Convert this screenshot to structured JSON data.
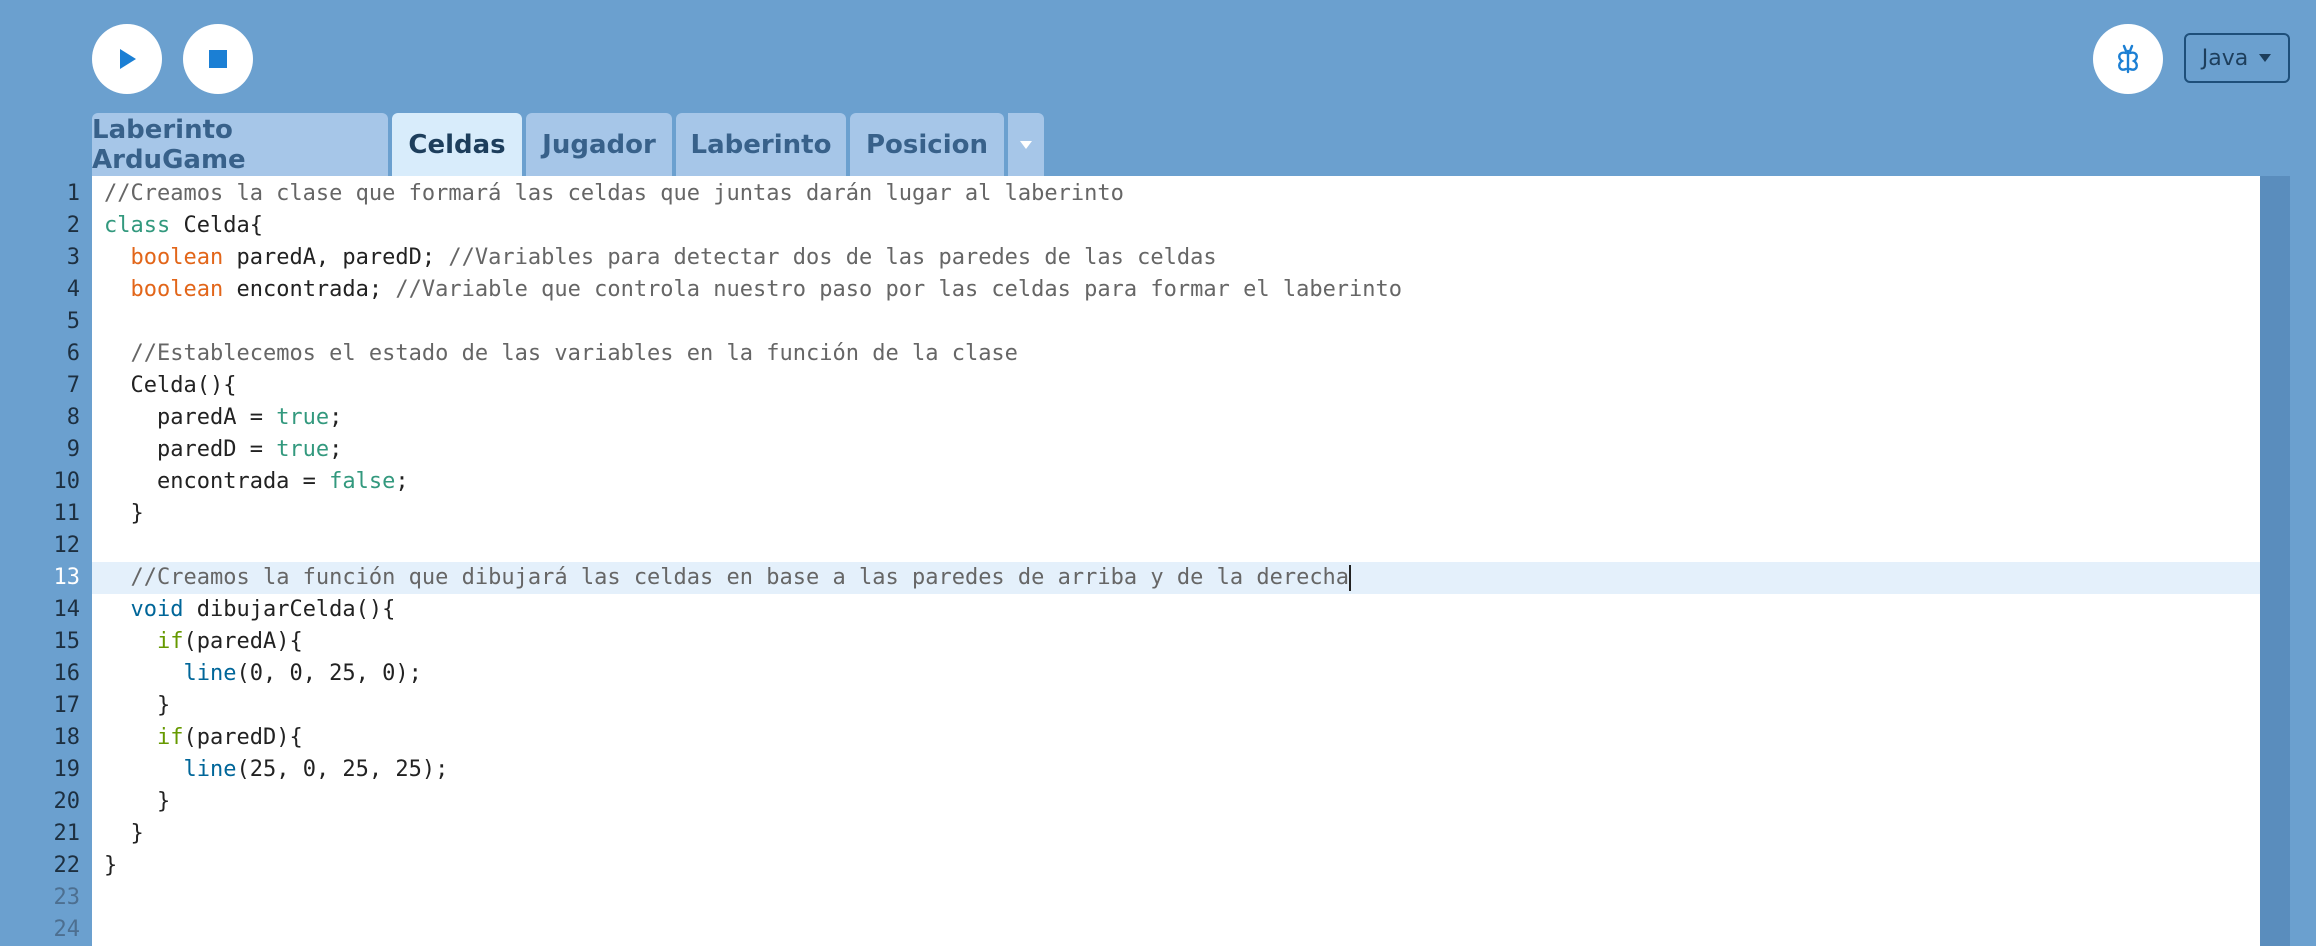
{
  "toolbar": {
    "run_icon": "play-icon",
    "stop_icon": "stop-icon",
    "mode_icon": "butterfly-icon",
    "language": "Java"
  },
  "tabs": [
    {
      "label": "Laberinto ArduGame",
      "active": false
    },
    {
      "label": "Celdas",
      "active": true
    },
    {
      "label": "Jugador",
      "active": false
    },
    {
      "label": "Laberinto",
      "active": false
    },
    {
      "label": "Posicion",
      "active": false
    }
  ],
  "editor": {
    "active_line": 13,
    "line_numbers": [
      "1",
      "2",
      "3",
      "4",
      "5",
      "6",
      "7",
      "8",
      "9",
      "10",
      "11",
      "12",
      "13",
      "14",
      "15",
      "16",
      "17",
      "18",
      "19",
      "20",
      "21",
      "22",
      "23",
      "24"
    ],
    "code_lines": [
      [
        {
          "t": "//Creamos la clase que formará las celdas que juntas darán lugar al laberinto",
          "c": "cmt"
        }
      ],
      [
        {
          "t": "class",
          "c": "kw"
        },
        {
          "t": " Celda{",
          "c": ""
        }
      ],
      [
        {
          "t": "  ",
          "c": ""
        },
        {
          "t": "boolean",
          "c": "type"
        },
        {
          "t": " paredA, paredD; ",
          "c": ""
        },
        {
          "t": "//Variables para detectar dos de las paredes de las celdas",
          "c": "cmt"
        }
      ],
      [
        {
          "t": "  ",
          "c": ""
        },
        {
          "t": "boolean",
          "c": "type"
        },
        {
          "t": " encontrada; ",
          "c": ""
        },
        {
          "t": "//Variable que controla nuestro paso por las celdas para formar el laberinto",
          "c": "cmt"
        }
      ],
      [],
      [
        {
          "t": "  ",
          "c": ""
        },
        {
          "t": "//Establecemos el estado de las variables en la función de la clase",
          "c": "cmt"
        }
      ],
      [
        {
          "t": "  Celda(){",
          "c": ""
        }
      ],
      [
        {
          "t": "    paredA = ",
          "c": ""
        },
        {
          "t": "true",
          "c": "lit"
        },
        {
          "t": ";",
          "c": ""
        }
      ],
      [
        {
          "t": "    paredD = ",
          "c": ""
        },
        {
          "t": "true",
          "c": "lit"
        },
        {
          "t": ";",
          "c": ""
        }
      ],
      [
        {
          "t": "    encontrada = ",
          "c": ""
        },
        {
          "t": "false",
          "c": "lit"
        },
        {
          "t": ";",
          "c": ""
        }
      ],
      [
        {
          "t": "  }",
          "c": ""
        }
      ],
      [],
      [
        {
          "t": "  ",
          "c": ""
        },
        {
          "t": "//Creamos la función que dibujará las celdas en base a las paredes de arriba y de la derecha",
          "c": "cmt"
        }
      ],
      [
        {
          "t": "  ",
          "c": ""
        },
        {
          "t": "void",
          "c": "fn"
        },
        {
          "t": " dibujarCelda(){",
          "c": ""
        }
      ],
      [
        {
          "t": "    ",
          "c": ""
        },
        {
          "t": "if",
          "c": "ctl"
        },
        {
          "t": "(paredA){",
          "c": ""
        }
      ],
      [
        {
          "t": "      ",
          "c": ""
        },
        {
          "t": "line",
          "c": "fn"
        },
        {
          "t": "(0, 0, 25, 0);",
          "c": ""
        }
      ],
      [
        {
          "t": "    }",
          "c": ""
        }
      ],
      [
        {
          "t": "    ",
          "c": ""
        },
        {
          "t": "if",
          "c": "ctl"
        },
        {
          "t": "(paredD){",
          "c": ""
        }
      ],
      [
        {
          "t": "      ",
          "c": ""
        },
        {
          "t": "line",
          "c": "fn"
        },
        {
          "t": "(25, 0, 25, 25);",
          "c": ""
        }
      ],
      [
        {
          "t": "    }",
          "c": ""
        }
      ],
      [
        {
          "t": "  }",
          "c": ""
        }
      ],
      [
        {
          "t": "}",
          "c": ""
        }
      ],
      [],
      []
    ]
  }
}
